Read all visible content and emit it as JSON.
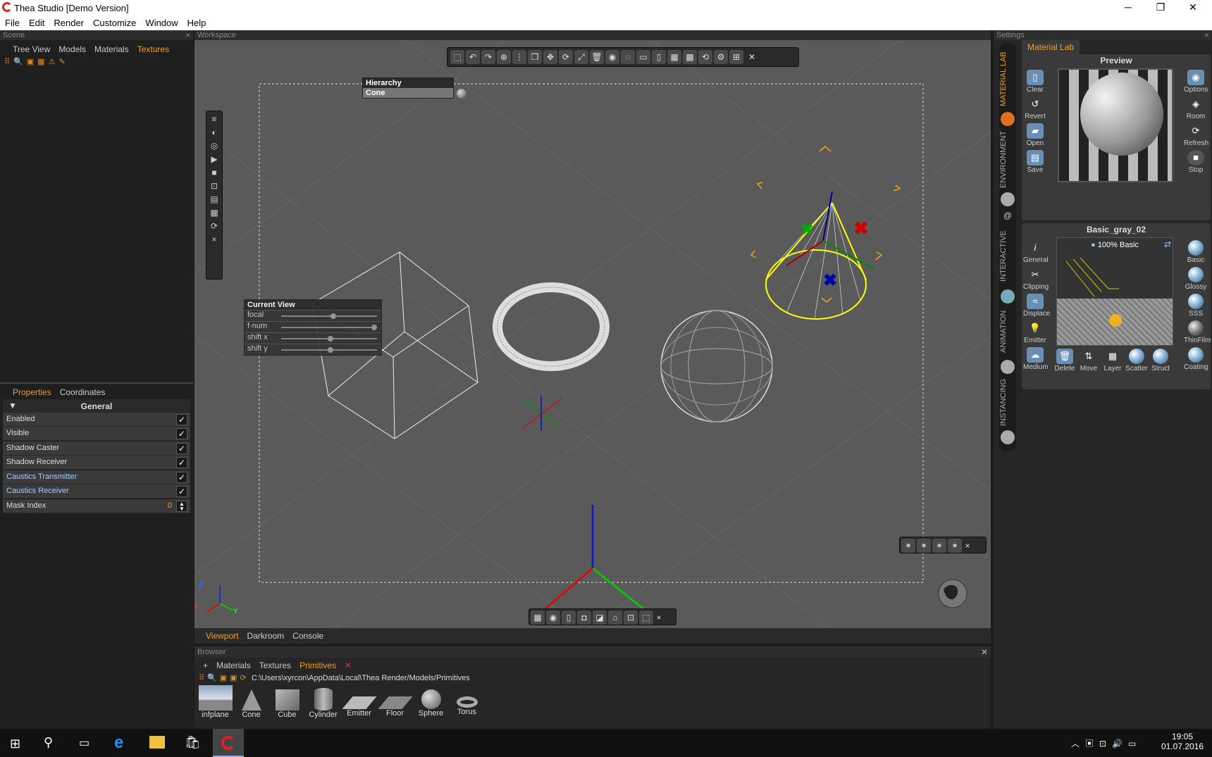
{
  "app": {
    "title": "Thea Studio [Demo Version]"
  },
  "window_controls": {
    "minimize": "─",
    "maximize": "❐",
    "close": "✕"
  },
  "menu": [
    "File",
    "Edit",
    "Render",
    "Customize",
    "Window",
    "Help"
  ],
  "scene": {
    "title": "Scene",
    "tabs": [
      "Tree View",
      "Models",
      "Materials",
      "Textures"
    ],
    "active_tab": "Textures"
  },
  "properties": {
    "tabs": [
      "Properties",
      "Coordinates"
    ],
    "section": "General",
    "rows": [
      {
        "label": "Enabled",
        "checked": "✓"
      },
      {
        "label": "Visible",
        "checked": "✓"
      },
      {
        "label": "Shadow Caster",
        "checked": "✓"
      },
      {
        "label": "Shadow Receiver",
        "checked": "✓"
      },
      {
        "label": "Caustics Transmitter",
        "checked": "✓"
      },
      {
        "label": "Caustics Receiver",
        "checked": "✓"
      }
    ],
    "mask_index": {
      "label": "Mask Index",
      "value": "0"
    }
  },
  "workspace": {
    "title": "Workspace",
    "hierarchy_title": "Hierarchy",
    "hierarchy_item": "Cone",
    "current_view": {
      "title": "Current View",
      "rows": [
        "focal",
        "f-num",
        "shift x",
        "shift y"
      ]
    },
    "axis": {
      "z": "Z",
      "x": "X",
      "y": "Y"
    },
    "bottom_tabs": [
      "Viewport",
      "Darkroom",
      "Console"
    ],
    "active_bottom_tab": "Viewport"
  },
  "browser": {
    "title": "Browser",
    "tabs": [
      "Materials",
      "Textures",
      "Primitives"
    ],
    "active_tab": "Primitives",
    "path": "C:\\Users\\xyrcon\\AppData\\Local\\Thea Render/Models/Primitives",
    "items": [
      "infplane",
      "Cone",
      "Cube",
      "Cylinder",
      "Emitter",
      "Floor",
      "Sphere",
      "Torus"
    ]
  },
  "settings": {
    "title": "Settings",
    "tab": "Material Lab",
    "preview_title": "Preview",
    "material_name": "Basic_gray_02",
    "layer": "100% Basic",
    "vtabs": [
      "MATERIAL LAB",
      "ENVIRONMENT",
      "INTERACTIVE",
      "ANIMATION",
      "INSTANCING"
    ],
    "left_buttons": [
      "Clear",
      "Revert",
      "Open",
      "Save"
    ],
    "right_buttons": [
      "Options",
      "Room",
      "Refresh",
      "Stop"
    ],
    "mat_left": [
      "General",
      "Clipping",
      "Displace",
      "Emitter",
      "Medium"
    ],
    "mat_right": [
      "Basic",
      "Glossy",
      "SSS",
      "ThinFilm",
      "Coating"
    ],
    "mat_bottom": [
      "Delete",
      "Move",
      "Layer",
      "Scatter",
      "Struct"
    ]
  },
  "taskbar": {
    "time": "19:05",
    "date": "01.07.2016"
  }
}
